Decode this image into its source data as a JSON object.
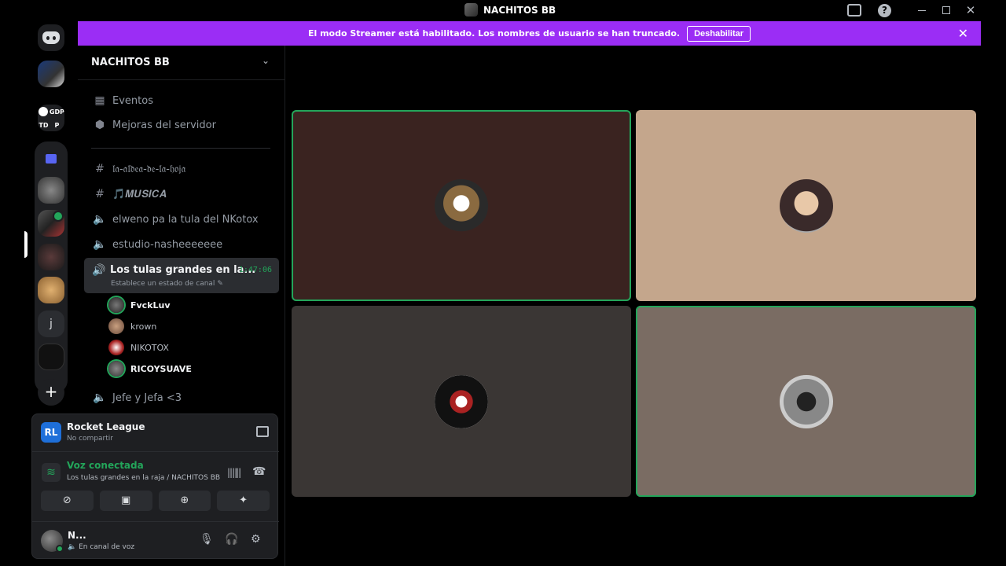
{
  "titlebar": {
    "title": "NACHITOS BB"
  },
  "rail": {
    "gdp_labels": [
      "GDP",
      "TD",
      "P"
    ],
    "j_label": "j",
    "add_label": "+"
  },
  "banner": {
    "text": "El modo Streamer está habilitado. Los nombres de usuario se han truncado.",
    "button": "Deshabilitar"
  },
  "server": {
    "name": "NACHITOS BB"
  },
  "sidebar": {
    "items": [
      {
        "label": "Eventos"
      },
      {
        "label": "Mejoras del servidor"
      }
    ],
    "channels": [
      {
        "label": "𝔩𝔞-𝔞𝔩𝔡𝔢𝔞-𝔡𝔢-𝔩𝔞-𝔥𝔬𝔧𝔞"
      },
      {
        "label": "🎵𝑴𝑼𝑺𝑰𝑪𝑨"
      },
      {
        "label": "elweno pa la tula del NKotox"
      },
      {
        "label": "estudio-nasheeeeeee"
      },
      {
        "label": "Jefe y Jefa <3"
      }
    ],
    "active_channel": {
      "name": "Los tulas grandes en la...",
      "time": "1:47:06",
      "status": "Establece un estado de canal"
    },
    "voice_users": [
      {
        "name": "FvckLuv"
      },
      {
        "name": "krown"
      },
      {
        "name": "NIKOTOX"
      },
      {
        "name": "RICOYSUAVE"
      }
    ]
  },
  "activity": {
    "title": "Rocket League",
    "subtitle": "No compartir"
  },
  "voice": {
    "title": "Voz conectada",
    "subtitle": "Los tulas grandes en la raja / NACHITOS BB"
  },
  "user": {
    "name": "N...",
    "status": "En canal de voz"
  },
  "colors": {
    "accent_banner": "#9b2df5",
    "speaking": "#23a55a",
    "tile1": "#3a2320",
    "tile2": "#c4a68c",
    "tile3": "#3a3634",
    "tile4": "#7a6c63"
  },
  "icons": [
    "discord-icon",
    "inbox-icon",
    "help-icon",
    "calendar-icon",
    "shield-icon",
    "hash-icon",
    "speaker-icon",
    "pencil-icon",
    "screen-share-icon",
    "signal-icon",
    "soundwave-icon",
    "hangup-icon",
    "camera-off-icon",
    "gamepad-icon",
    "activity-icon",
    "microphone-icon",
    "headphones-icon",
    "gear-icon",
    "close-icon",
    "chevron-down-icon",
    "folder-icon",
    "plus-icon"
  ]
}
